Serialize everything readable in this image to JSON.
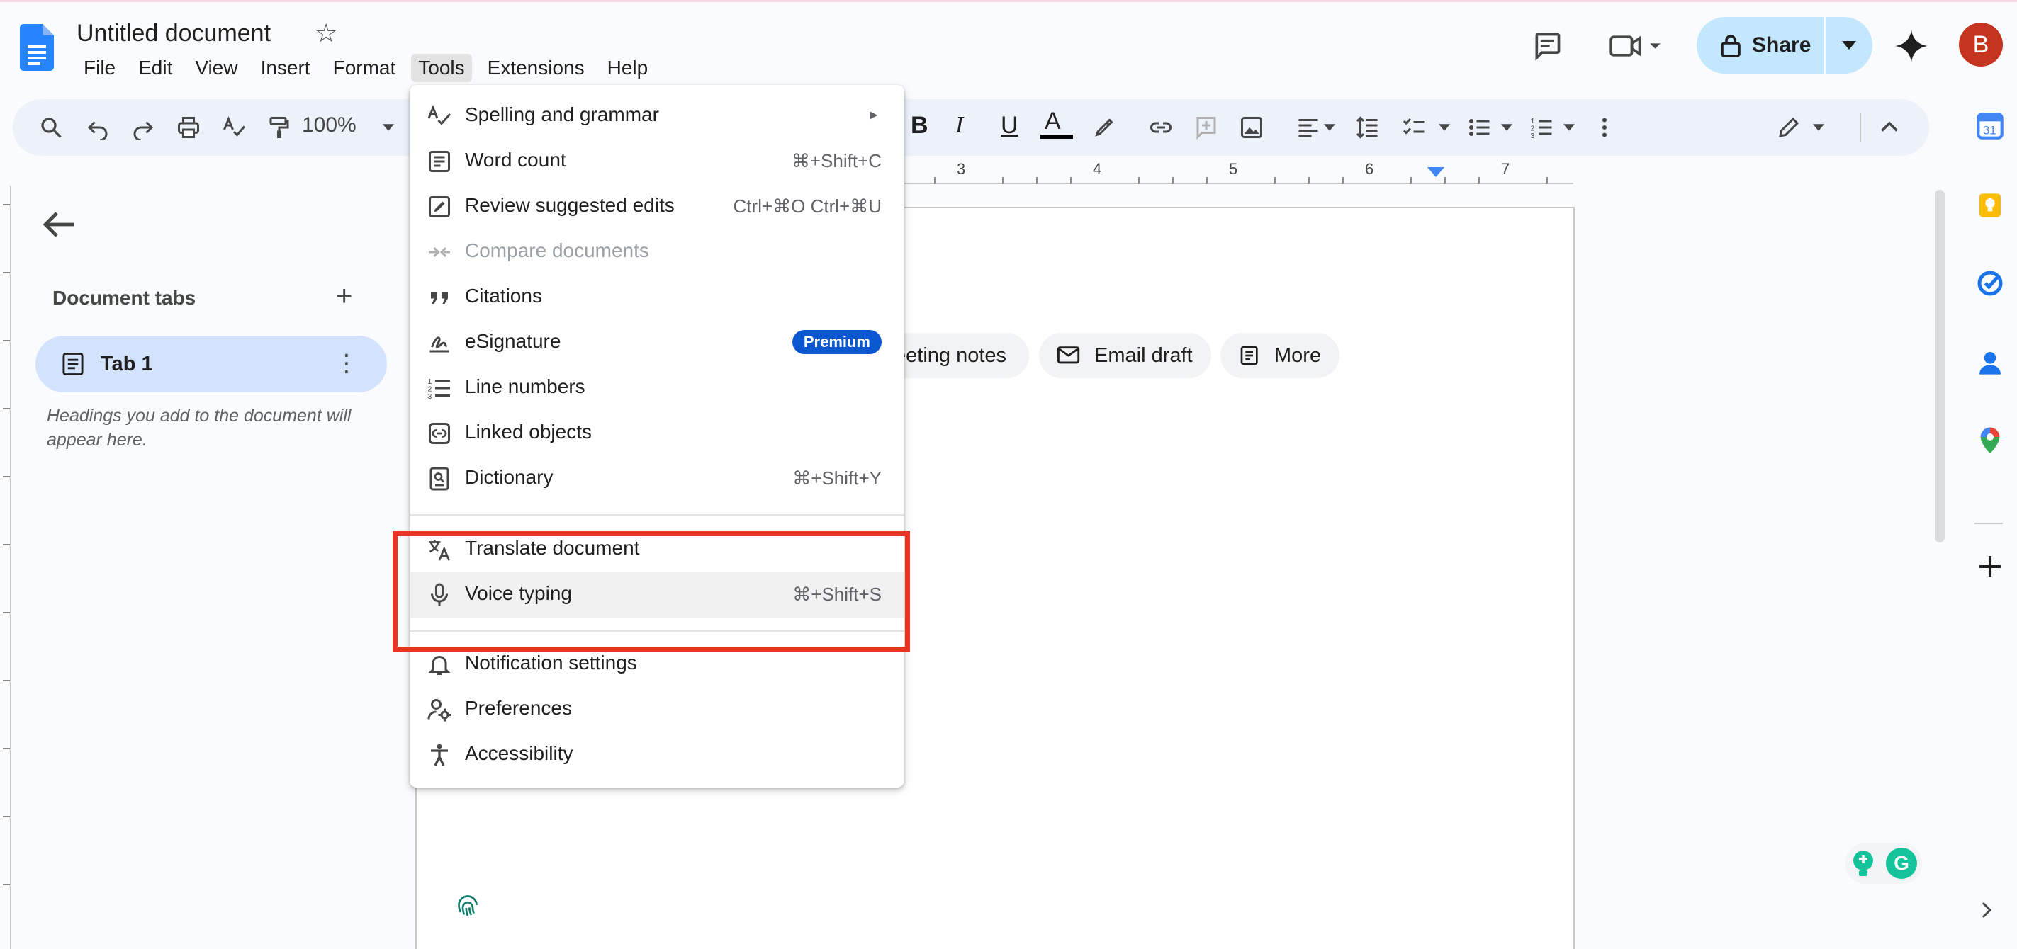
{
  "document": {
    "title": "Untitled document"
  },
  "menubar": {
    "items": [
      {
        "label": "File"
      },
      {
        "label": "Edit"
      },
      {
        "label": "View"
      },
      {
        "label": "Insert"
      },
      {
        "label": "Format"
      },
      {
        "label": "Tools"
      },
      {
        "label": "Extensions"
      },
      {
        "label": "Help"
      }
    ],
    "active": "Tools"
  },
  "header": {
    "share_label": "Share",
    "avatar_initial": "B"
  },
  "toolbar": {
    "zoom": "100%",
    "bold": "B",
    "italic": "I",
    "underline": "U",
    "text_color": "A"
  },
  "ruler": {
    "labels": [
      "3",
      "4",
      "5",
      "6",
      "7"
    ]
  },
  "sidebar": {
    "title": "Document tabs",
    "tab_label": "Tab 1",
    "hint": "Headings you add to the document will appear here."
  },
  "page": {
    "chips": [
      {
        "label": "eeting notes"
      },
      {
        "label": "Email draft"
      },
      {
        "label": "More"
      }
    ]
  },
  "tools_menu": {
    "items": [
      {
        "label": "Spelling and grammar",
        "shortcut": "",
        "icon": "spellcheck-icon",
        "submenu": true
      },
      {
        "label": "Word count",
        "shortcut": "⌘+Shift+C",
        "icon": "word-count-icon"
      },
      {
        "label": "Review suggested edits",
        "shortcut": "Ctrl+⌘O Ctrl+⌘U",
        "icon": "review-edits-icon"
      },
      {
        "label": "Compare documents",
        "shortcut": "",
        "icon": "compare-icon",
        "disabled": true
      },
      {
        "label": "Citations",
        "shortcut": "",
        "icon": "quote-icon"
      },
      {
        "label": "eSignature",
        "shortcut": "",
        "icon": "signature-icon",
        "badge": "Premium"
      },
      {
        "label": "Line numbers",
        "shortcut": "",
        "icon": "line-numbers-icon"
      },
      {
        "label": "Linked objects",
        "shortcut": "",
        "icon": "linked-objects-icon"
      },
      {
        "label": "Dictionary",
        "shortcut": "⌘+Shift+Y",
        "icon": "dictionary-icon"
      },
      {
        "label": "Translate document",
        "shortcut": "",
        "icon": "translate-icon"
      },
      {
        "label": "Voice typing",
        "shortcut": "⌘+Shift+S",
        "icon": "microphone-icon"
      },
      {
        "label": "Notification settings",
        "shortcut": "",
        "icon": "bell-icon"
      },
      {
        "label": "Preferences",
        "shortcut": "",
        "icon": "preferences-icon"
      },
      {
        "label": "Accessibility",
        "shortcut": "",
        "icon": "accessibility-icon"
      }
    ]
  },
  "colors": {
    "accent": "#0b57d0",
    "share_bg": "#c2e7ff",
    "tab_bg": "#d3e3fd",
    "highlight": "#ea3323",
    "avatar": "#c5341f"
  }
}
